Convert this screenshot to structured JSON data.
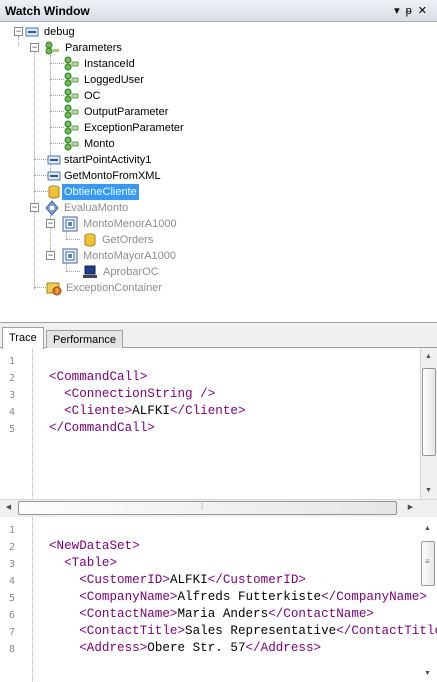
{
  "window": {
    "title": "Watch Window",
    "buttons_glyphs": "▾ ⊥ ✕"
  },
  "tree": {
    "items": [
      {
        "label": "debug",
        "icon": "activity-icon"
      },
      {
        "label": "Parameters",
        "icon": "parameters-icon"
      },
      {
        "label": "InstanceId",
        "icon": "parameter-icon"
      },
      {
        "label": "LoggedUser",
        "icon": "parameter-icon"
      },
      {
        "label": "OC",
        "icon": "parameter-icon"
      },
      {
        "label": "OutputParameter",
        "icon": "parameter-icon"
      },
      {
        "label": "ExceptionParameter",
        "icon": "parameter-icon"
      },
      {
        "label": "Monto",
        "icon": "parameter-icon"
      },
      {
        "label": "startPointActivity1",
        "icon": "activity-icon"
      },
      {
        "label": "GetMontoFromXML",
        "icon": "activity-icon"
      },
      {
        "label": "ObtieneCliente",
        "icon": "database-icon",
        "selected": true
      },
      {
        "label": "EvaluaMonto",
        "icon": "decision-icon",
        "disabled": true
      },
      {
        "label": "MontoMenorA1000",
        "icon": "branch-icon",
        "disabled": true
      },
      {
        "label": "GetOrders",
        "icon": "database-icon",
        "disabled": true
      },
      {
        "label": "MontoMayorA1000",
        "icon": "branch-icon",
        "disabled": true
      },
      {
        "label": "AprobarOC",
        "icon": "computer-icon",
        "disabled": true
      },
      {
        "label": "ExceptionContainer",
        "icon": "exception-icon",
        "disabled": true
      }
    ]
  },
  "tabs": [
    {
      "label": "Trace",
      "active": true
    },
    {
      "label": "Performance",
      "active": false
    }
  ],
  "trace_pane": {
    "line_numbers": [
      "1",
      "2",
      "3",
      "4",
      "5"
    ],
    "lines": [
      "",
      "<CommandCall>",
      "  <ConnectionString />",
      "  <Cliente>ALFKI</Cliente>",
      "</CommandCall>"
    ]
  },
  "result_pane": {
    "line_numbers": [
      "1",
      "2",
      "3",
      "4",
      "5",
      "6",
      "7",
      "8"
    ],
    "lines": [
      "",
      "<NewDataSet>",
      "  <Table>",
      "    <CustomerID>ALFKI</CustomerID>",
      "    <CompanyName>Alfreds Futterkiste</CompanyName>",
      "    <ContactName>Maria Anders</ContactName>",
      "    <ContactTitle>Sales Representative</ContactTitle>",
      "    <Address>Obere Str. 57</Address>"
    ]
  },
  "colors": {
    "xml_tag": "#800080",
    "selection": "#3399ff",
    "disabled_text": "#8d8d8d"
  }
}
